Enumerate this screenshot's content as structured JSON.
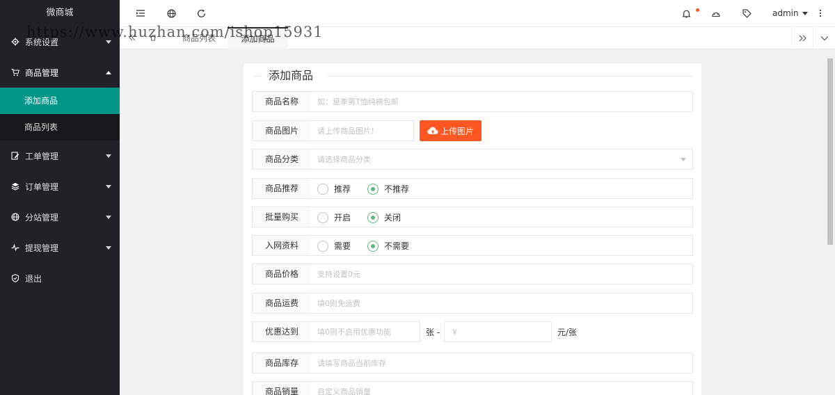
{
  "app": {
    "title": "微商城"
  },
  "watermark": "https://www.huzhan.com/ishop15931",
  "sidebar": {
    "items": [
      {
        "label": "系统设置",
        "icon": "gear-icon"
      },
      {
        "label": "商品管理",
        "icon": "cart-icon",
        "sub": [
          {
            "label": "添加商品",
            "active": true
          },
          {
            "label": "商品列表"
          }
        ]
      },
      {
        "label": "工单管理",
        "icon": "edit-icon"
      },
      {
        "label": "订单管理",
        "icon": "layers-icon"
      },
      {
        "label": "分站管理",
        "icon": "globe-icon"
      },
      {
        "label": "提现管理",
        "icon": "pulse-icon"
      },
      {
        "label": "退出",
        "icon": "shield-icon"
      }
    ]
  },
  "header": {
    "user": "admin"
  },
  "tabs": {
    "items": [
      {
        "label": "商品列表"
      },
      {
        "label": "添加商品",
        "active": true
      }
    ]
  },
  "form": {
    "legend": "添加商品",
    "name": {
      "label": "商品名称",
      "placeholder": "如：夏季男T恤纯棉包邮"
    },
    "image": {
      "label": "商品图片",
      "placeholder": "请上传商品图片！",
      "button": "上传图片"
    },
    "category": {
      "label": "商品分类",
      "placeholder": "请选择商品分类"
    },
    "recommend": {
      "label": "商品推荐",
      "options": [
        "推荐",
        "不推荐"
      ],
      "selected": "不推荐"
    },
    "batch": {
      "label": "批量购买",
      "options": [
        "开启",
        "关闭"
      ],
      "selected": "关闭"
    },
    "network": {
      "label": "入网资料",
      "options": [
        "需要",
        "不需要"
      ],
      "selected": "不需要"
    },
    "price": {
      "label": "商品价格",
      "placeholder": "支持设置0元"
    },
    "shipping": {
      "label": "商品运费",
      "placeholder": "填0则免运费"
    },
    "discount": {
      "label": "优惠达到",
      "placeholder": "填0则不启用优惠功能",
      "unit1": "张 -",
      "currency": "￥",
      "unit2": "元/张"
    },
    "stock": {
      "label": "商品库存",
      "placeholder": "请填写商品当前库存"
    },
    "sales": {
      "label": "商品销量",
      "placeholder": "自定义商品销量"
    }
  },
  "colors": {
    "sidebar": "#20222a",
    "active": "#009688",
    "accent": "#ff5722",
    "radio": "#5fb878"
  }
}
